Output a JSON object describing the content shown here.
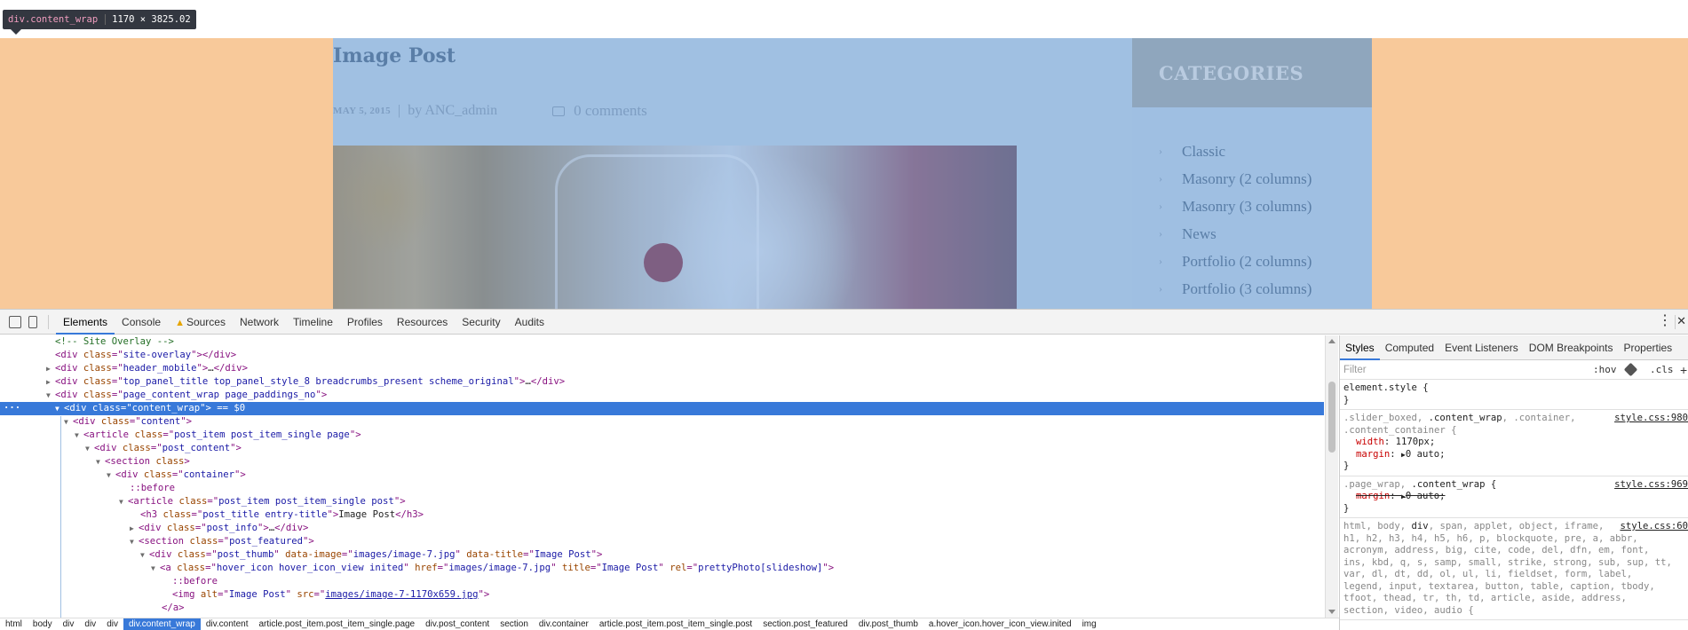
{
  "inspect_tooltip": {
    "tag": "div.content_wrap",
    "dims": "1170 × 3825.02"
  },
  "page": {
    "post_title": "Image Post",
    "post_date": "MAY 5, 2015",
    "separator": "|",
    "author": "by ANC_admin",
    "comments": "0 comments",
    "sidebar_title": "CATEGORIES",
    "categories": [
      "Classic",
      "Masonry (2 columns)",
      "Masonry (3 columns)",
      "News",
      "Portfolio (2 columns)",
      "Portfolio (3 columns)"
    ]
  },
  "devtools": {
    "tabs": [
      "Elements",
      "Console",
      "Sources",
      "Network",
      "Timeline",
      "Profiles",
      "Resources",
      "Security",
      "Audits"
    ],
    "active_tab": "Elements",
    "elements": {
      "selected_marker": "== $0",
      "ellipsis": "…",
      "comment": "<!-- Site Overlay -->",
      "site_overlay": {
        "tag": "div",
        "class": "site-overlay"
      },
      "header_mobile": {
        "tag": "div",
        "class": "header_mobile"
      },
      "top_panel": {
        "tag": "div",
        "class": "top_panel_title top_panel_style_8 breadcrumbs_present scheme_original"
      },
      "page_content_wrap": {
        "tag": "div",
        "class": "page_content_wrap page_paddings_no"
      },
      "content_wrap": {
        "tag": "div",
        "class": "content_wrap"
      },
      "content": {
        "tag": "div",
        "class": "content"
      },
      "article1": {
        "tag": "article",
        "class": "post_item post_item_single page"
      },
      "post_content": {
        "tag": "div",
        "class": "post_content"
      },
      "section": {
        "tag": "section",
        "attr": "class"
      },
      "container": {
        "tag": "div",
        "class": "container"
      },
      "before1": "::before",
      "article2": {
        "tag": "article",
        "class": "post_item post_item_single post"
      },
      "h3": {
        "tag": "h3",
        "class": "post_title entry-title",
        "text": "Image Post"
      },
      "post_info": {
        "tag": "div",
        "class": "post_info"
      },
      "post_featured": {
        "tag": "section",
        "class": "post_featured"
      },
      "post_thumb": {
        "tag": "div",
        "class": "post_thumb",
        "data_image": "images/image-7.jpg",
        "data_title": "Image Post"
      },
      "anchor": {
        "tag": "a",
        "class": "hover_icon hover_icon_view inited",
        "href": "images/image-7.jpg",
        "title": "Image Post",
        "rel": "prettyPhoto[slideshow]"
      },
      "before2": "::before",
      "img": {
        "tag": "img",
        "alt": "Image Post",
        "src": "images/image-7-1170x659.jpg"
      },
      "a_close": "</a>"
    },
    "breadcrumbs": [
      "html",
      "body",
      "div",
      "div",
      "div",
      "div.content_wrap",
      "div.content",
      "article.post_item.post_item_single.page",
      "div.post_content",
      "section",
      "div.container",
      "article.post_item.post_item_single.post",
      "section.post_featured",
      "div.post_thumb",
      "a.hover_icon.hover_icon_view.inited",
      "img"
    ],
    "selected_crumb": "div.content_wrap",
    "styles_tabs": [
      "Styles",
      "Computed",
      "Event Listeners",
      "DOM Breakpoints",
      "Properties"
    ],
    "filter_placeholder": "Filter",
    "hov": ":hov",
    "cls": ".cls",
    "plus": "+",
    "rules": {
      "r1": {
        "selector": "element.style {",
        "close": "}"
      },
      "r2": {
        "sel_a": ".slider_boxed, ",
        "sel_b": ".content_wrap",
        "sel_c": ", .container,",
        "sel_d": ".content_container {",
        "source": "style.css:980",
        "p1n": "width",
        "p1v": "1170px;",
        "p2n": "margin",
        "p2v": "0 auto;",
        "close": "}"
      },
      "r3": {
        "sel_a": ".page_wrap, ",
        "sel_b": ".content_wrap",
        "sel_c": " {",
        "source": "style.css:969",
        "p1n": "margin",
        "p1v": "0 auto;",
        "close": "}"
      },
      "r4": {
        "source": "style.css:60",
        "l1a": "html, body, ",
        "l1b": "div",
        "l1c": ", span, applet, object, iframe,",
        "l2": "h1, h2, h3, h4, h5, h6, p, blockquote, pre, a, abbr,",
        "l3": "acronym, address, big, cite, code, del, dfn, em, font,",
        "l4": "ins, kbd, q, s, samp, small, strike, strong, sub, sup, tt,",
        "l5": "var, dl, dt, dd, ol, ul, li, fieldset, form, label,",
        "l6": "legend, input, textarea, button, table, caption, tbody,",
        "l7": "tfoot, thead, tr, th, td, article, aside, address,",
        "l8": "section, video, audio {"
      }
    }
  }
}
